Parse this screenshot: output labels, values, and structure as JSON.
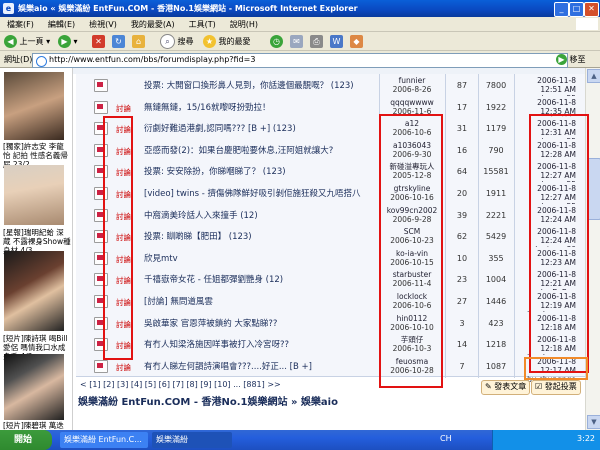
{
  "window": {
    "title": "娛樂aio « 娛樂滿紛 EntFun.COM - 香港No.1娛樂網站 - Microsoft Internet Explorer",
    "minimize_label": "_",
    "maximize_label": "□",
    "close_label": "✕"
  },
  "menu": [
    "檔案(F)",
    "編輯(E)",
    "檢視(V)",
    "我的最愛(A)",
    "工具(T)",
    "說明(H)"
  ],
  "toolbar": {
    "back_label": "上一頁",
    "search_label": "搜尋",
    "favorites_label": "我的最愛"
  },
  "address": {
    "label": "網址(D)",
    "url": "http://www.entfun.com/bbs/forumdisplay.php?fid=3",
    "go_label": "移至"
  },
  "sidebar": {
    "captions": [
      "[獨家]許志安 李龍怡 記拍 性感名義帰屁 23/2",
      "[星報]瑞明紀蛤 深蔵 不露裸身Show種身材 4/3",
      "[短片]陳詩琪 喝Bill愛侶 嗎情我口水成多毛 4/3",
      "[短片]陳碧琪 萬迭 樂基 見 聽從別人 19/5"
    ]
  },
  "threads": [
    {
      "tag": "",
      "title": "投票: 大開窗口換形鼻人見到，你話邊個最靚嘅？ (123)",
      "author": "funnier",
      "date": "2006-8-26",
      "replies": "87",
      "views": "7800",
      "last_time": "2006-11-8 12:51 AM",
      "last_by": "by nec55"
    },
    {
      "tag": "討論",
      "title": "無鏈無鏈，15/16就嚟呀扮勁拉！",
      "author": "qqqqwwww",
      "date": "2006-11-6",
      "replies": "17",
      "views": "1922",
      "last_time": "2006-11-8 12:35 AM",
      "last_by": "by 單手一線價"
    },
    {
      "tag": "討論",
      "title": "衍劇好難過港劇,認同嗎??? [B +] (123)",
      "author": "a12",
      "date": "2006-10-6",
      "replies": "31",
      "views": "1179",
      "last_time": "2006-11-8 12:31 AM",
      "last_by": "by nec55"
    },
    {
      "tag": "討論",
      "title": "亞感而發(2)：如果台慶肥啦要休息,汪阿姐就讓大?",
      "author": "a1036043",
      "date": "2006-9-30",
      "replies": "16",
      "views": "790",
      "last_time": "2006-11-8 12:28 AM",
      "last_by": "by nec55"
    },
    {
      "tag": "討論",
      "title": "投票: 安安除扮，你睇嗰睇了？ (123)",
      "author": "新碰溢專玩人",
      "date": "2005-12-8",
      "replies": "64",
      "views": "15581",
      "last_time": "2006-11-8 12:27 AM",
      "last_by": "by nec55"
    },
    {
      "tag": "討論",
      "title": "[video] twins - 擠傷佛隊鮮好吸引剝佢施狂殺又九唔搭八",
      "author": "gtrskyline",
      "date": "2006-10-16",
      "replies": "20",
      "views": "1911",
      "last_time": "2006-11-8 12:27 AM",
      "last_by": "by nec55"
    },
    {
      "tag": "討論",
      "title": "中窩滴美玲話人入來撞手 (12)",
      "author": "kov99cn2002",
      "date": "2006-9-28",
      "replies": "39",
      "views": "2221",
      "last_time": "2006-11-8 12:24 AM",
      "last_by": "by nec55"
    },
    {
      "tag": "討論",
      "title": "投票: 瞓啲睇【肥田】 (123)",
      "author": "SCM",
      "date": "2006-10-23",
      "replies": "62",
      "views": "5429",
      "last_time": "2006-11-8 12:24 AM",
      "last_by": "by tmau80"
    },
    {
      "tag": "討論",
      "title": "欣見mtv",
      "author": "ko-ia-vin",
      "date": "2006-10-15",
      "replies": "10",
      "views": "355",
      "last_time": "2006-11-8 12:23 AM",
      "last_by": "by nec55"
    },
    {
      "tag": "討論",
      "title": "千禧嶽帝女花 - 任姐都彈劉艷身 (12)",
      "author": "starbuster",
      "date": "2006-11-4",
      "replies": "23",
      "views": "1004",
      "last_time": "2006-11-8 12:21 AM",
      "last_by": "by D_Boy"
    },
    {
      "tag": "討論",
      "title": "[討論] 無問道風雲",
      "author": "locklock",
      "date": "2006-10-6",
      "replies": "27",
      "views": "1446",
      "last_time": "2006-11-8 12:19 AM",
      "last_by": "by chungngo"
    },
    {
      "tag": "討論",
      "title": "吳啟華家 官恩萍被鎖約 大家點睇??",
      "author": "hin0112",
      "date": "2006-10-10",
      "replies": "3",
      "views": "423",
      "last_time": "2006-11-8 12:18 AM",
      "last_by": "by nec55"
    },
    {
      "tag": "討論",
      "title": "有冇人知梁洛施因咩事被打入冷宮呀??",
      "author": "芋頭仔",
      "date": "2006-10-3",
      "replies": "14",
      "views": "1218",
      "last_time": "2006-11-8 12:18 AM",
      "last_by": "by chungngo"
    },
    {
      "tag": "討論",
      "title": "有冇人睇左何韻詩演唱會???....好正... [B +]",
      "author": "feuosma",
      "date": "2006-10-28",
      "replies": "7",
      "views": "1087",
      "last_time": "2006-11-8 12:17 AM",
      "last_by": "by chungngo"
    }
  ],
  "pager": "< [1] [2] [3] [4] [5] [6] [7] [8] [9] [10] ... [881] >>",
  "footer_title": "娛樂滿紛 EntFun.COM - 香港No.1娛樂網站 » 娛樂aio",
  "buttons": {
    "post_thread": "發表文章",
    "post_poll": "發起投票"
  },
  "taskbar": {
    "start_label": "開始",
    "tasks": [
      "娛樂滿紛 EntFun.C...",
      "娛樂滿紛"
    ],
    "lang": "CH",
    "clock": "3:22"
  },
  "colors": {
    "annotation_red": "#e21212",
    "annotation_orange": "#f08a2a",
    "xp_blue": "#245edc"
  }
}
